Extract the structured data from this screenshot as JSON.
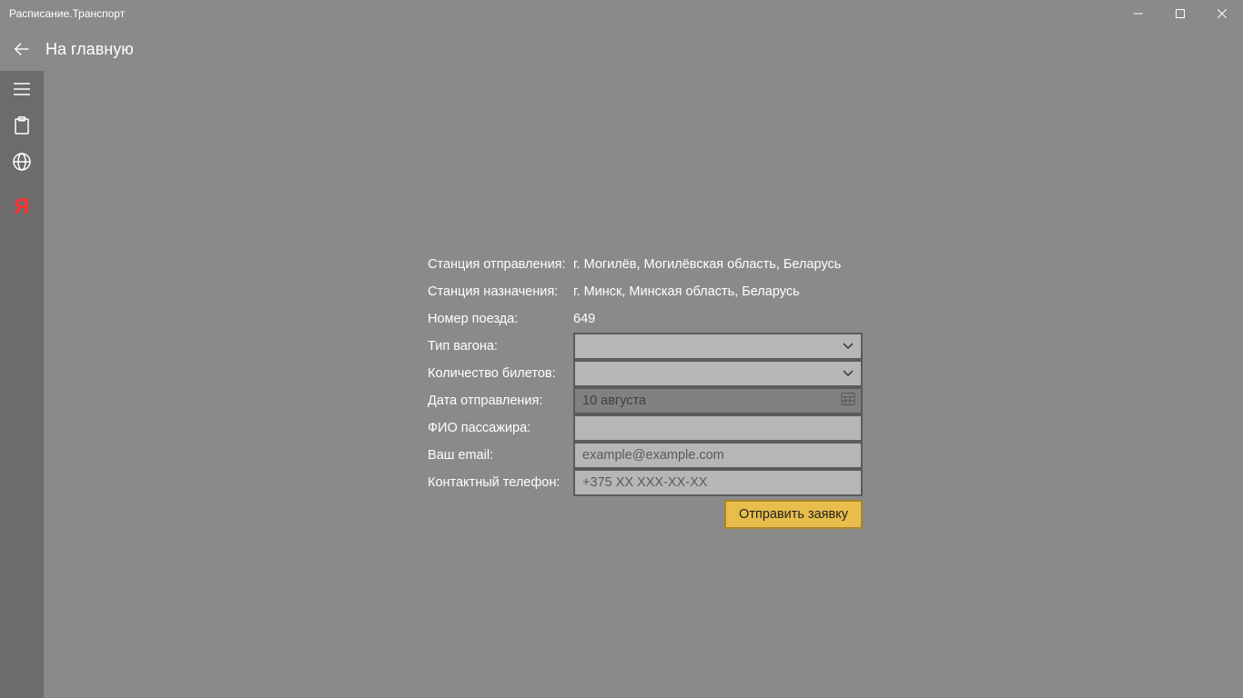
{
  "window": {
    "title": "Расписание.Транспорт"
  },
  "header": {
    "back_label": "На главную"
  },
  "sidebar": {
    "yandex_letter": "Я"
  },
  "form": {
    "departure_station_label": "Станция отправления:",
    "departure_station_value": "г. Могилёв, Могилёвская область, Беларусь",
    "destination_station_label": "Станция назначения:",
    "destination_station_value": "г. Минск, Минская область, Беларусь",
    "train_number_label": "Номер поезда:",
    "train_number_value": "649",
    "wagon_type_label": "Тип вагона:",
    "ticket_count_label": "Количество билетов:",
    "departure_date_label": "Дата отправления:",
    "departure_date_value": "10 августа",
    "passenger_name_label": "ФИО пассажира:",
    "email_label": "Ваш email:",
    "email_placeholder": "example@example.com",
    "phone_label": "Контактный телефон:",
    "phone_placeholder": "+375 XX XXX-XX-XX",
    "submit_label": "Отправить заявку"
  }
}
